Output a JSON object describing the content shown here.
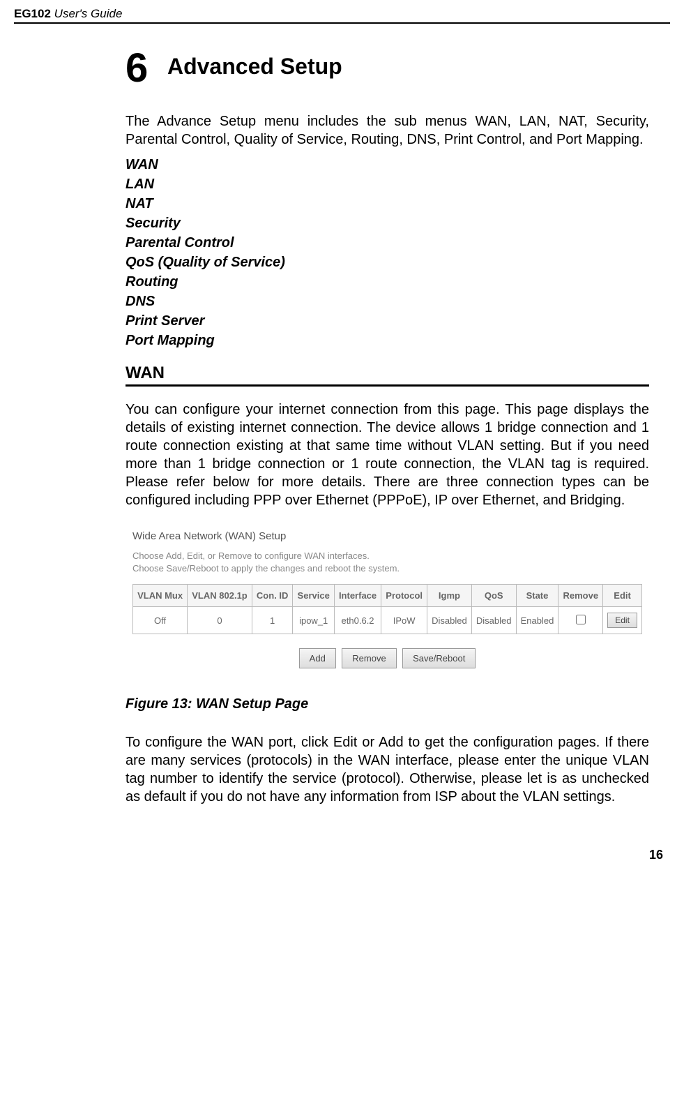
{
  "header": {
    "product": "EG102",
    "guide": "User's Guide"
  },
  "chapter": {
    "number": "6",
    "title": "Advanced Setup"
  },
  "intro": "The Advance Setup menu includes the sub menus WAN, LAN, NAT, Security, Parental Control, Quality of Service, Routing, DNS, Print Control, and Port Mapping.",
  "toc": {
    "item1": "WAN",
    "item2": "LAN",
    "item3": "NAT",
    "item4": "Security",
    "item5": "Parental Control",
    "item6": "QoS (Quality of Service)",
    "item7": "Routing",
    "item8": "DNS",
    "item9": "Print Server",
    "item10": "Port Mapping"
  },
  "section": {
    "heading": "WAN",
    "para1": "You can configure your internet connection from this page. This page displays the details of existing internet connection. The device allows 1 bridge connection and 1 route connection existing at that same time without VLAN setting. But if you need more than 1 bridge connection or 1 route connection, the VLAN tag is required. Please refer below for more details. There are three connection types can be configured including PPP over Ethernet (PPPoE), IP over Ethernet, and Bridging.",
    "para2": "To configure the WAN port, click Edit or Add to get the configuration pages. If there are many services (protocols) in the WAN interface, please enter the unique VLAN tag number to identify the service (protocol). Otherwise, please let is as unchecked as default if you do not have any information from ISP about the VLAN settings."
  },
  "wan_setup": {
    "title": "Wide Area Network (WAN) Setup",
    "instr1": "Choose Add, Edit, or Remove to configure WAN interfaces.",
    "instr2": "Choose Save/Reboot to apply the changes and reboot the system.",
    "headers": {
      "h1": "VLAN Mux",
      "h2": "VLAN 802.1p",
      "h3": "Con. ID",
      "h4": "Service",
      "h5": "Interface",
      "h6": "Protocol",
      "h7": "Igmp",
      "h8": "QoS",
      "h9": "State",
      "h10": "Remove",
      "h11": "Edit"
    },
    "row1": {
      "c1": "Off",
      "c2": "0",
      "c3": "1",
      "c4": "ipow_1",
      "c5": "eth0.6.2",
      "c6": "IPoW",
      "c7": "Disabled",
      "c8": "Disabled",
      "c9": "Enabled",
      "c11": "Edit"
    },
    "buttons": {
      "add": "Add",
      "remove": "Remove",
      "save": "Save/Reboot"
    }
  },
  "figure_caption": "Figure 13: WAN Setup Page",
  "page_number": "16"
}
